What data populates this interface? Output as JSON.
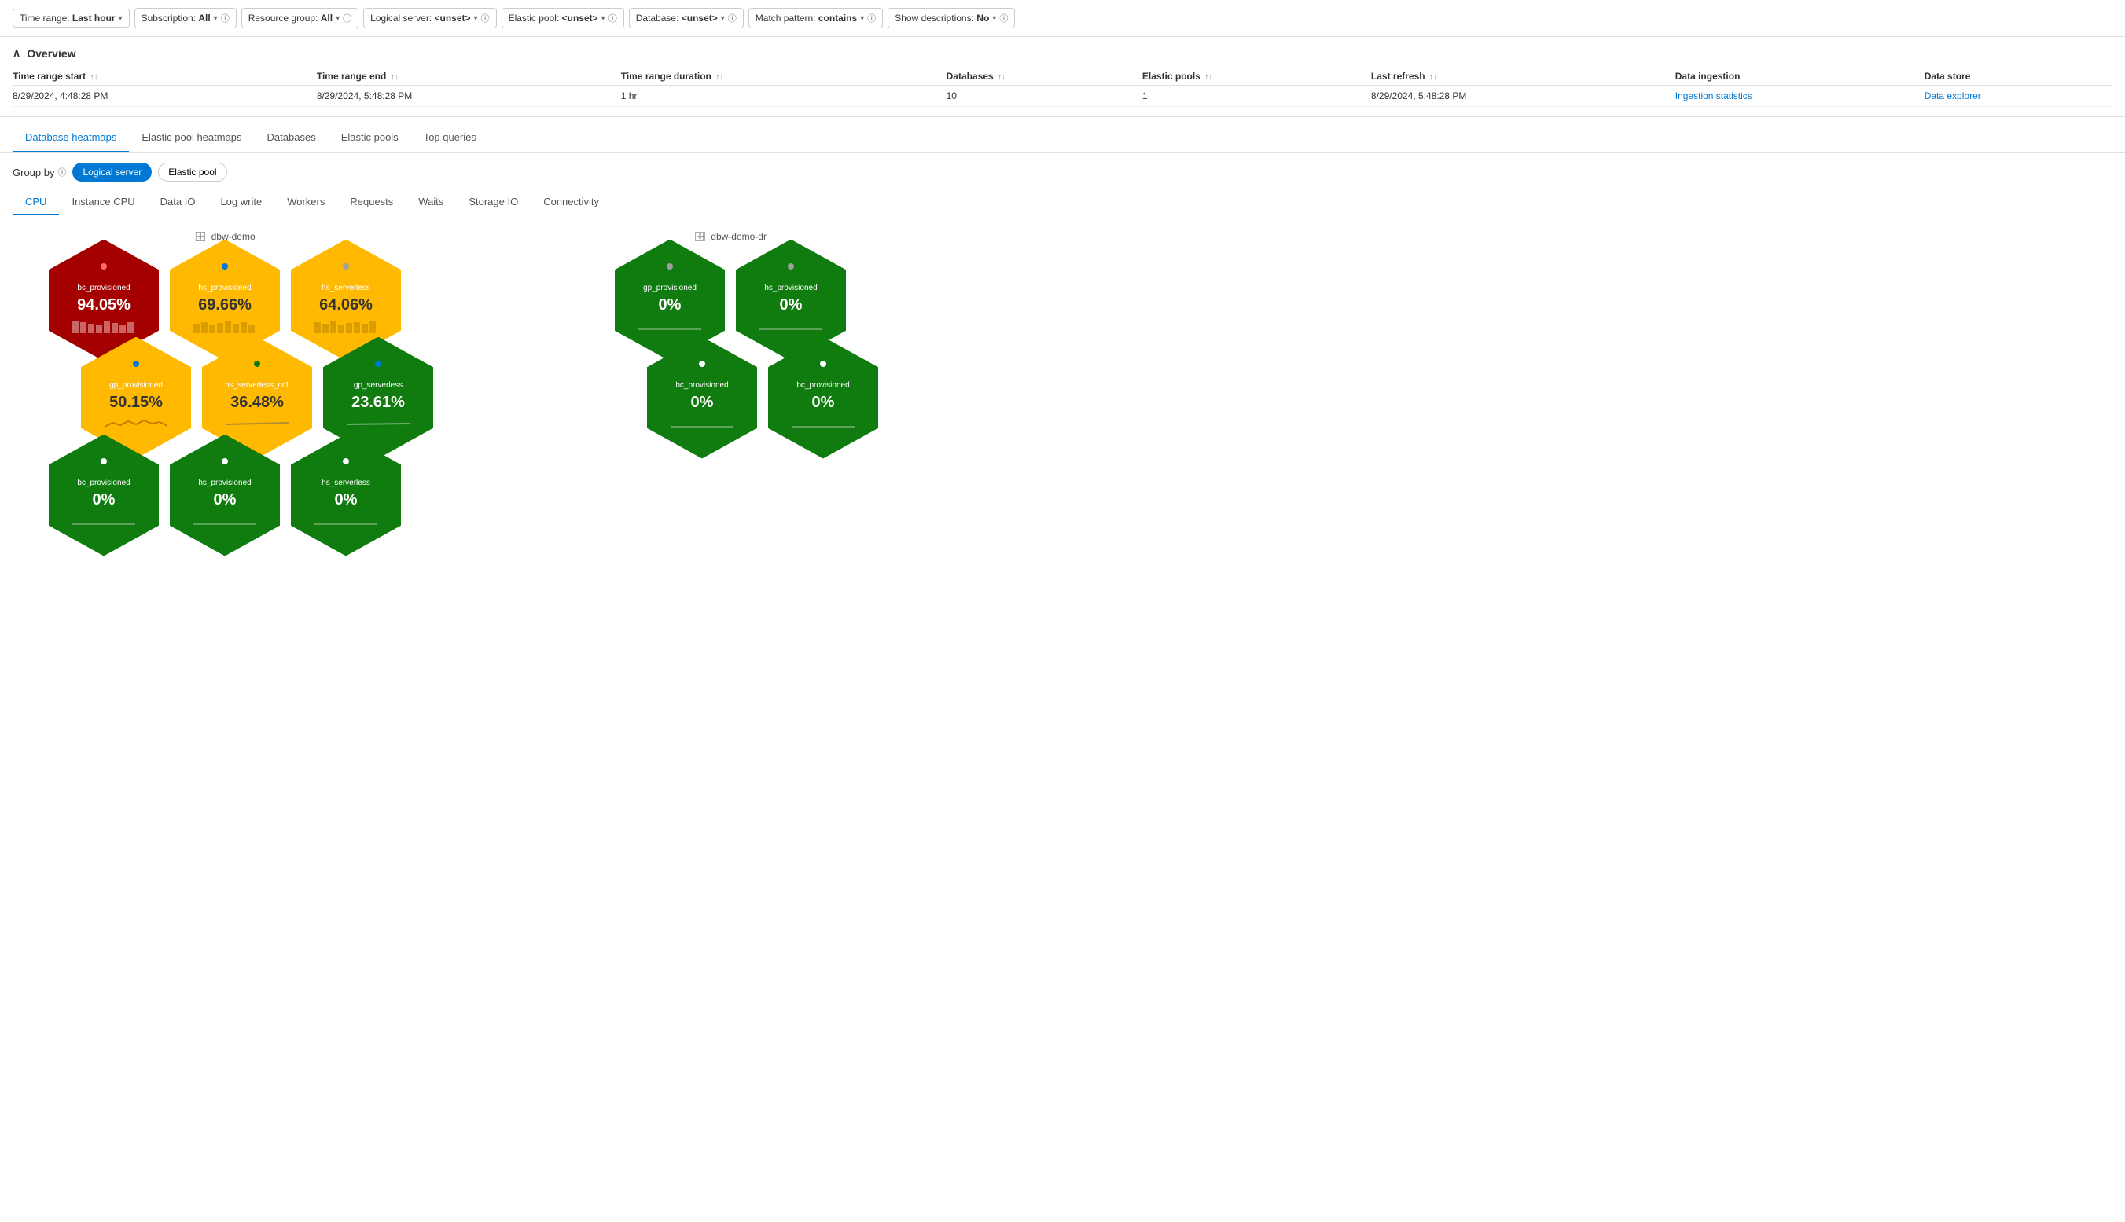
{
  "filters": [
    {
      "label": "Time range:",
      "value": "Last hour",
      "has_info": false
    },
    {
      "label": "Subscription:",
      "value": "All",
      "has_info": true
    },
    {
      "label": "Resource group:",
      "value": "All",
      "has_info": true
    },
    {
      "label": "Logical server:",
      "value": "<unset>",
      "has_info": true
    },
    {
      "label": "Elastic pool:",
      "value": "<unset>",
      "has_info": true
    },
    {
      "label": "Database:",
      "value": "<unset>",
      "has_info": true
    },
    {
      "label": "Match pattern:",
      "value": "contains",
      "has_info": true
    },
    {
      "label": "Show descriptions:",
      "value": "No",
      "has_info": true
    }
  ],
  "overview": {
    "title": "Overview",
    "columns": [
      {
        "label": "Time range start",
        "sortable": true
      },
      {
        "label": "Time range end",
        "sortable": true
      },
      {
        "label": "Time range duration",
        "sortable": true
      },
      {
        "label": "Databases",
        "sortable": true
      },
      {
        "label": "Elastic pools",
        "sortable": true
      },
      {
        "label": "Last refresh",
        "sortable": true
      },
      {
        "label": "Data ingestion",
        "sortable": false
      },
      {
        "label": "Data store",
        "sortable": false
      }
    ],
    "row": {
      "time_start": "8/29/2024, 4:48:28 PM",
      "time_end": "8/29/2024, 5:48:28 PM",
      "duration": "1 hr",
      "databases": "10",
      "elastic_pools": "1",
      "last_refresh": "8/29/2024, 5:48:28 PM",
      "data_ingestion_link": "Ingestion statistics",
      "data_store_link": "Data explorer"
    }
  },
  "main_tabs": [
    {
      "label": "Database heatmaps",
      "active": true
    },
    {
      "label": "Elastic pool heatmaps",
      "active": false
    },
    {
      "label": "Databases",
      "active": false
    },
    {
      "label": "Elastic pools",
      "active": false
    },
    {
      "label": "Top queries",
      "active": false
    }
  ],
  "group_by": {
    "label": "Group by",
    "options": [
      {
        "label": "Logical server",
        "active": true
      },
      {
        "label": "Elastic pool",
        "active": false
      }
    ]
  },
  "metric_tabs": [
    {
      "label": "CPU",
      "active": true
    },
    {
      "label": "Instance CPU",
      "active": false
    },
    {
      "label": "Data IO",
      "active": false
    },
    {
      "label": "Log write",
      "active": false
    },
    {
      "label": "Workers",
      "active": false
    },
    {
      "label": "Requests",
      "active": false
    },
    {
      "label": "Waits",
      "active": false
    },
    {
      "label": "Storage IO",
      "active": false
    },
    {
      "label": "Connectivity",
      "active": false
    }
  ],
  "heatmap_groups": [
    {
      "name": "dbw-demo",
      "hexagons": [
        {
          "row": 0,
          "col": 0,
          "color": "red",
          "dot_color": "#ff6b6b",
          "name": "bc_provisioned",
          "value": "94.05%",
          "sparkline": "bar"
        },
        {
          "row": 0,
          "col": 1,
          "color": "yellow",
          "dot_color": "#0078d4",
          "name": "hs_provisioned",
          "value": "69.66%",
          "sparkline": "bar"
        },
        {
          "row": 0,
          "col": 2,
          "color": "yellow",
          "dot_color": "#a0a0a0",
          "name": "hs_serverless",
          "value": "64.06%",
          "sparkline": "bar"
        },
        {
          "row": 1,
          "col": 0,
          "color": "yellow",
          "dot_color": "#0078d4",
          "name": "gp_provisioned",
          "value": "50.15%",
          "sparkline": "wave"
        },
        {
          "row": 1,
          "col": 1,
          "color": "yellow",
          "dot_color": "#107c10",
          "name": "hs_serverless_nr1",
          "value": "36.48%",
          "sparkline": "line"
        },
        {
          "row": 1,
          "col": 2,
          "color": "green",
          "dot_color": "#0078d4",
          "name": "gp_serverless",
          "value": "23.61%",
          "sparkline": "line"
        },
        {
          "row": 2,
          "col": 0,
          "color": "green",
          "dot_color": "#ffffff",
          "name": "bc_provisioned",
          "value": "0%",
          "sparkline": "flat"
        },
        {
          "row": 2,
          "col": 1,
          "color": "green",
          "dot_color": "#ffffff",
          "name": "hs_provisioned",
          "value": "0%",
          "sparkline": "flat"
        },
        {
          "row": 2,
          "col": 2,
          "color": "green",
          "dot_color": "#ffffff",
          "name": "hs_serverless",
          "value": "0%",
          "sparkline": "flat"
        }
      ]
    },
    {
      "name": "dbw-demo-dr",
      "hexagons": [
        {
          "row": 0,
          "col": 0,
          "color": "green",
          "dot_color": "#a0a0a0",
          "name": "gp_provisioned",
          "value": "0%",
          "sparkline": "flat"
        },
        {
          "row": 0,
          "col": 1,
          "color": "green",
          "dot_color": "#a0a0a0",
          "name": "hs_provisioned",
          "value": "0%",
          "sparkline": "flat"
        },
        {
          "row": 1,
          "col": 0,
          "color": "green",
          "dot_color": "#ffffff",
          "name": "bc_provisioned",
          "value": "0%",
          "sparkline": "flat"
        },
        {
          "row": 1,
          "col": 1,
          "color": "green",
          "dot_color": "#ffffff",
          "name": "bc_provisioned",
          "value": "0%",
          "sparkline": "flat"
        }
      ]
    }
  ]
}
